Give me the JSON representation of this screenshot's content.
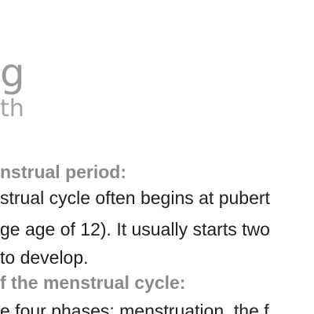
{
  "logo": {
    "letter": "g",
    "subtext": "th"
  },
  "content": {
    "heading_1": "nstrual period:",
    "paragraph_1_line_1": "strual cycle often begins at pubert",
    "paragraph_1_line_2": "ge age of 12). It usually starts two",
    "paragraph_1_line_3": " to develop.",
    "heading_2": "f the menstrual cycle:",
    "paragraph_2_line_1": "e four phases:  menstruation, the f"
  }
}
